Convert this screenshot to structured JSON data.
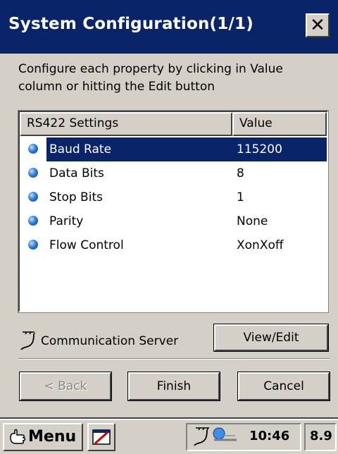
{
  "window": {
    "title": "System Configuration(1/1)",
    "close_label": "✕"
  },
  "instructions": "Configure each property by clicking in Value column or hitting the Edit button",
  "list": {
    "headers": [
      "RS422 Settings",
      "Value"
    ],
    "rows": [
      {
        "name": "Baud Rate",
        "value": "115200",
        "selected": true
      },
      {
        "name": "Data Bits",
        "value": "8",
        "selected": false
      },
      {
        "name": "Stop Bits",
        "value": "1",
        "selected": false
      },
      {
        "name": "Parity",
        "value": "None",
        "selected": false
      },
      {
        "name": "Flow Control",
        "value": "XonXoff",
        "selected": false
      }
    ]
  },
  "comm_server_label": "Communication Server",
  "buttons": {
    "view_edit": "View/Edit",
    "back": "< Back",
    "finish": "Finish",
    "cancel": "Cancel"
  },
  "taskbar": {
    "start_label": "Menu",
    "clock": "10:46",
    "indicator": "8.9"
  },
  "colors": {
    "title_bar": "#0a246a",
    "selection": "#0a246a",
    "face": "#d4d0c8"
  }
}
